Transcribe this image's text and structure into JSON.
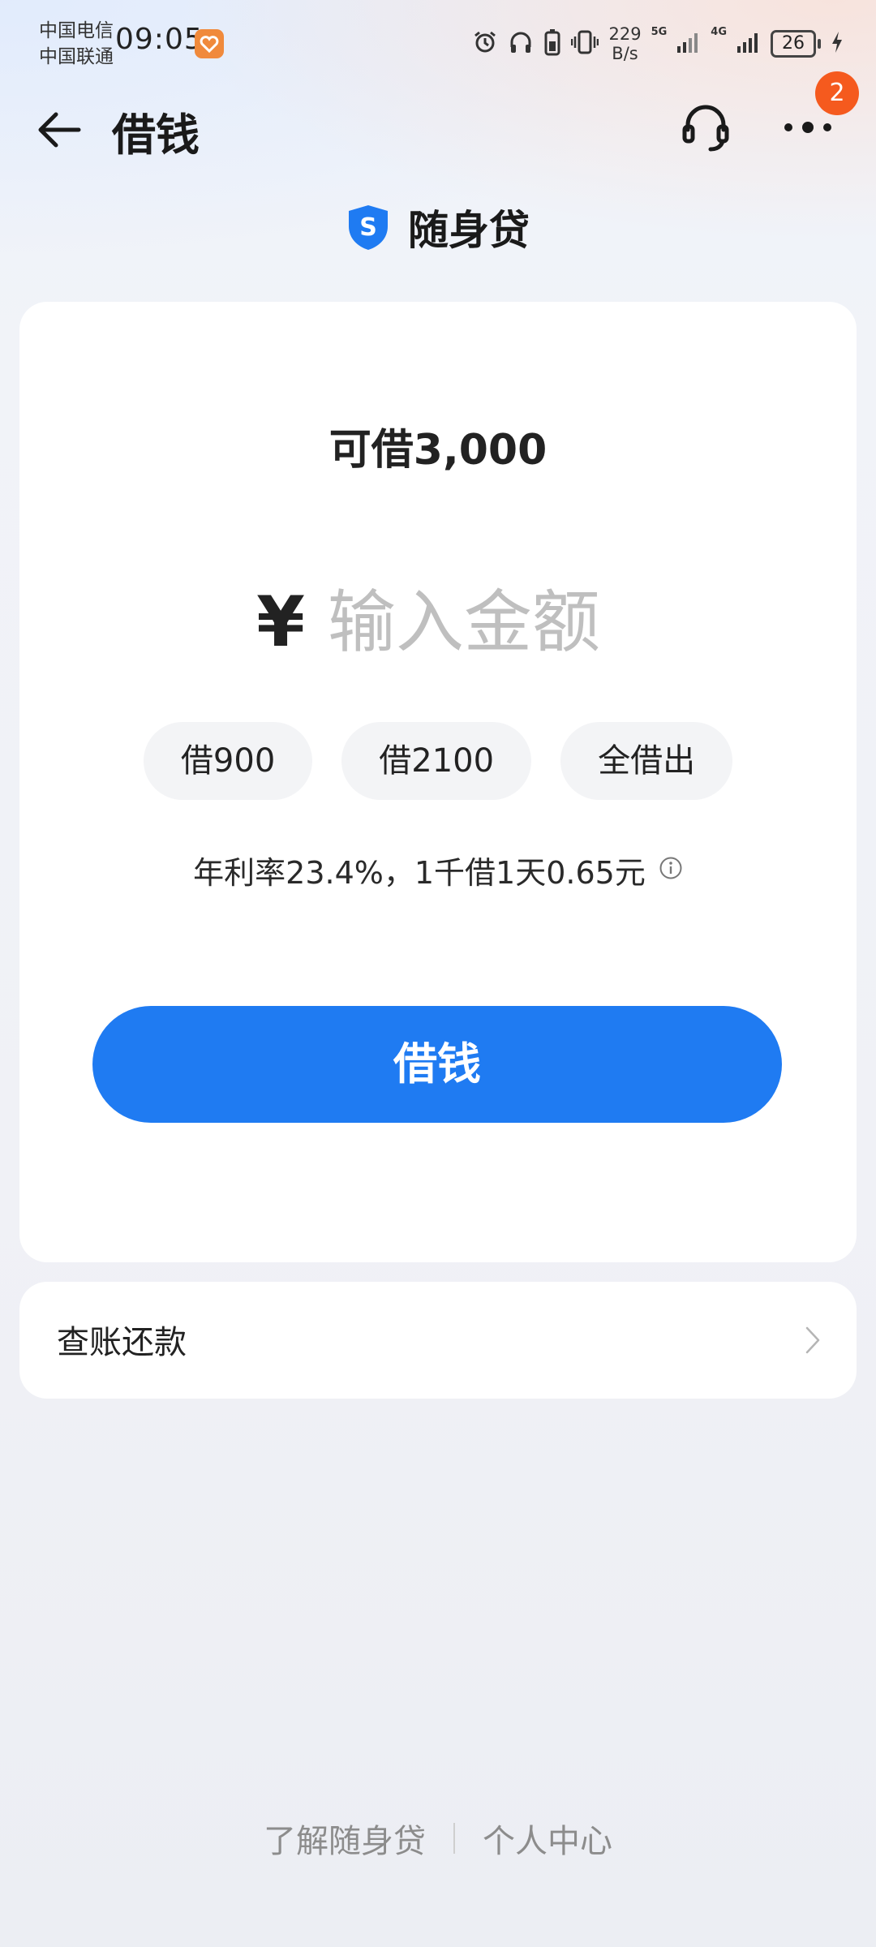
{
  "status_bar": {
    "carrier_1": "中国电信",
    "carrier_2": "中国联通",
    "time": "09:05",
    "net_speed_value": "229",
    "net_speed_unit": "B/s",
    "signal_1_tag": "5G",
    "signal_2_tag": "4G",
    "battery": "26"
  },
  "header": {
    "title": "借钱",
    "more_badge": "2"
  },
  "product": {
    "name": "随身贷",
    "logo_letter": "S"
  },
  "loan_card": {
    "available_label": "可借",
    "available_amount": "3,000",
    "currency_symbol": "¥",
    "amount_placeholder": "输入金额",
    "quick_options": [
      "借900",
      "借2100",
      "全借出"
    ],
    "rate_text": "年利率23.4%，1千借1天0.65元",
    "borrow_button": "借钱"
  },
  "bill": {
    "label": "查账还款"
  },
  "footer": {
    "learn_link": "了解随身贷",
    "profile_link": "个人中心"
  },
  "colors": {
    "primary": "#1f7bf2",
    "badge": "#f55a1e",
    "logo_blue": "#1f7bf2"
  }
}
